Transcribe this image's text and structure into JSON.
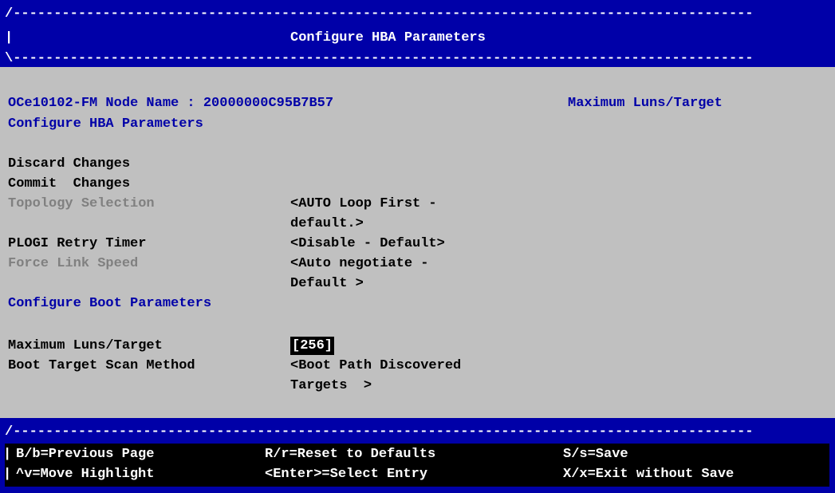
{
  "header": {
    "border_top": "/-------------------------------------------------------------------------------------------",
    "title_prefix": "|",
    "title": "Configure HBA Parameters",
    "border_bottom": "\\-------------------------------------------------------------------------------------------"
  },
  "info": {
    "node_line": "OCe10102-FM Node Name : 20000000C95B7B57",
    "help_title": "Maximum Luns/Target",
    "section": "Configure HBA Parameters"
  },
  "menu": {
    "discard": "Discard Changes",
    "commit": "Commit  Changes",
    "topology_label": "Topology Selection",
    "topology_value_1": "<AUTO Loop First -",
    "topology_value_2": "default.>",
    "plogi_label": "PLOGI Retry Timer",
    "plogi_value": "<Disable - Default>",
    "link_label": "Force Link Speed",
    "link_value_1": "<Auto negotiate -",
    "link_value_2": "Default >",
    "boot_section": "Configure Boot Parameters",
    "luns_label": "Maximum Luns/Target",
    "luns_value": "[256]",
    "scan_label": "Boot Target Scan Method",
    "scan_value_1": "<Boot Path Discovered",
    "scan_value_2": "Targets  >"
  },
  "footer": {
    "border_top": "/-------------------------------------------------------------------------------------------",
    "bar": "|",
    "prev": "B/b=Previous Page",
    "reset": "R/r=Reset to Defaults",
    "save": "S/s=Save",
    "move": "^v=Move Highlight",
    "select": "<Enter>=Select Entry",
    "exit": "X/x=Exit without Save"
  }
}
